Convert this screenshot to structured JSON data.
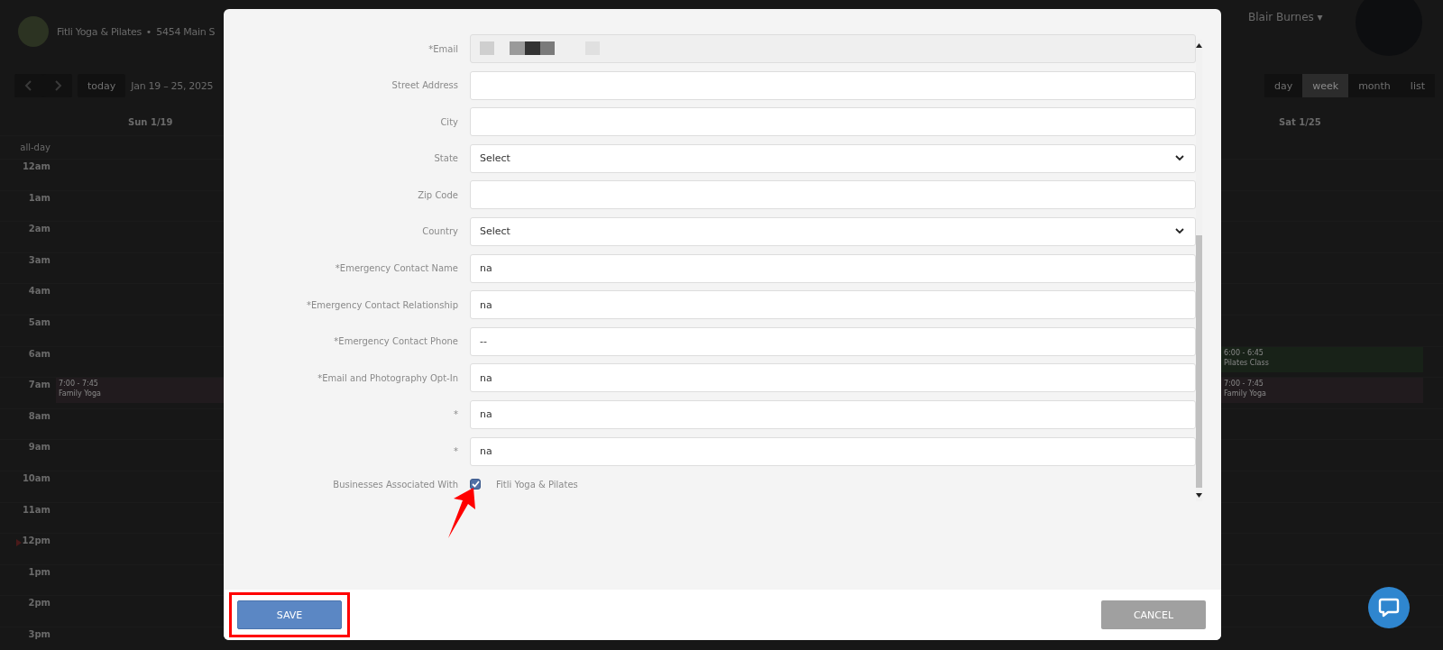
{
  "background": {
    "header": {
      "business": "Fitli Yoga & Pilates",
      "separator": "•",
      "address": "5454 Main S",
      "user": "Blair Burnes",
      "caret": "▾"
    },
    "toolbar": {
      "today": "today",
      "range": "Jan 19 – 25, 2025",
      "views": [
        {
          "label": "day",
          "selected": false
        },
        {
          "label": "week",
          "selected": true
        },
        {
          "label": "month",
          "selected": false
        },
        {
          "label": "list",
          "selected": false
        }
      ]
    },
    "columns": {
      "left": "Sun 1/19",
      "right": "Sat 1/25"
    },
    "all_day": "all-day",
    "rows": [
      {
        "time": "12am"
      },
      {
        "time": "1am"
      },
      {
        "time": "2am"
      },
      {
        "time": "3am"
      },
      {
        "time": "4am"
      },
      {
        "time": "5am"
      },
      {
        "time": "6am",
        "right": {
          "time": "6:00 - 6:45",
          "title": "Pilates Class",
          "color": "#182218"
        }
      },
      {
        "time": "7am",
        "left": {
          "time": "7:00 - 7:45",
          "title": "Family Yoga",
          "color": "#211b1e"
        },
        "right": {
          "time": "7:00 - 7:45",
          "title": "Family Yoga",
          "color": "#211b1e"
        }
      },
      {
        "time": "8am"
      },
      {
        "time": "9am"
      },
      {
        "time": "10am"
      },
      {
        "time": "11am"
      },
      {
        "time": "12pm",
        "now": true
      },
      {
        "time": "1pm"
      },
      {
        "time": "2pm"
      },
      {
        "time": "3pm"
      }
    ]
  },
  "modal": {
    "fields": [
      {
        "kind": "redacted",
        "label": "*Email"
      },
      {
        "kind": "text",
        "label": "Street Address"
      },
      {
        "kind": "text",
        "label": "City"
      },
      {
        "kind": "select",
        "label": "State",
        "value": "Select"
      },
      {
        "kind": "text",
        "label": "Zip Code"
      },
      {
        "kind": "select",
        "label": "Country",
        "value": "Select"
      },
      {
        "kind": "text",
        "label": "*Emergency Contact Name",
        "value": "na"
      },
      {
        "kind": "text",
        "label": "*Emergency Contact Relationship",
        "value": "na"
      },
      {
        "kind": "text",
        "label": "*Emergency Contact Phone",
        "value": "--"
      },
      {
        "kind": "text",
        "label": "*Email and Photography Opt-In",
        "value": "na"
      },
      {
        "kind": "text",
        "label": "*",
        "value": "na"
      },
      {
        "kind": "text",
        "label": "*",
        "value": "na"
      }
    ],
    "business": {
      "label": "Businesses Associated With",
      "option": "Fitli Yoga & Pilates",
      "checked": true
    },
    "save": "SAVE",
    "cancel": "CANCEL"
  }
}
